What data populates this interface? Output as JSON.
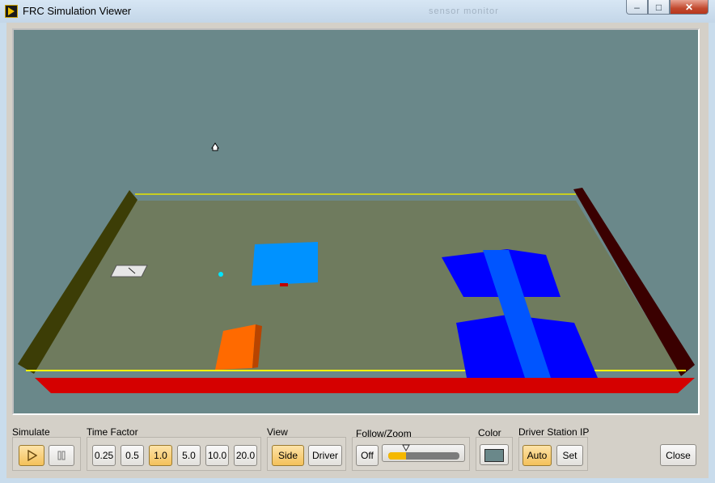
{
  "window": {
    "title": "FRC Simulation Viewer",
    "ghost_text": "sensor monitor"
  },
  "titlebar_buttons": {
    "minimize": "–",
    "maximize": "□",
    "close": "✕"
  },
  "controls": {
    "simulate": {
      "label": "Simulate",
      "play_icon": "play-icon",
      "pause_icon": "pause-icon",
      "playing": true
    },
    "time_factor": {
      "label": "Time Factor",
      "options": [
        "0.25",
        "0.5",
        "1.0",
        "5.0",
        "10.0",
        "20.0"
      ],
      "selected": "1.0"
    },
    "view": {
      "label": "View",
      "options": [
        "Side",
        "Driver"
      ],
      "selected": "Side"
    },
    "follow_zoom": {
      "label": "Follow/Zoom",
      "off_label": "Off",
      "level": 0.25
    },
    "color": {
      "label": "Color",
      "swatch": "#6a888a"
    },
    "driver_station_ip": {
      "label": "Driver Station IP",
      "auto_label": "Auto",
      "set_label": "Set",
      "selected": "Auto"
    },
    "close_label": "Close"
  },
  "colors": {
    "accent_active": "#f4c15a",
    "field_floor": "#6f7b5e",
    "sky": "#6a888a",
    "wall_left": "#3c3d06",
    "wall_right": "#3a0000",
    "wall_front": "#d50000",
    "blue_light": "#0092ff",
    "blue_dark": "#0000ff",
    "orange": "#ff6a00"
  }
}
